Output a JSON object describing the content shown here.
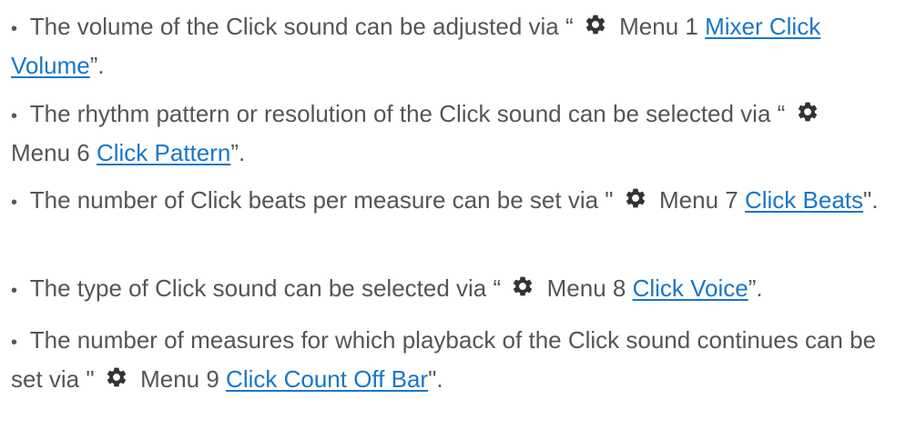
{
  "bullets": [
    {
      "symbol": "•",
      "before": "The volume of the Click sound can be adjusted via “",
      "icon": "gear-icon",
      "menu": "Menu 1",
      "link": "Mixer Click Volume",
      "after": "”."
    },
    {
      "symbol": "•",
      "before": "The rhythm pattern or resolution of the Click sound can be selected via “",
      "icon": "gear-icon",
      "menu": "Menu 6",
      "link": "Click Pattern",
      "after": "”."
    },
    {
      "symbol": "•",
      "before": "The number of Click beats per measure can be set via \"",
      "icon": "gear-icon",
      "menu": "Menu 7",
      "link": "Click Beats",
      "after": "\"."
    },
    {
      "symbol": "•",
      "before": "The type of Click sound can be selected via “",
      "icon": "gear-icon",
      "menu": "Menu 8",
      "link": "Click Voice",
      "after": "”."
    },
    {
      "symbol": "•",
      "before": "The number of measures for which playback of the Click sound continues can be set via \"",
      "icon": "gear-icon",
      "menu": "Menu 9",
      "link": "Click Count Off Bar",
      "after": "\"."
    }
  ],
  "colors": {
    "text": "#555555",
    "link": "#1976c9",
    "icon": "#333333"
  }
}
